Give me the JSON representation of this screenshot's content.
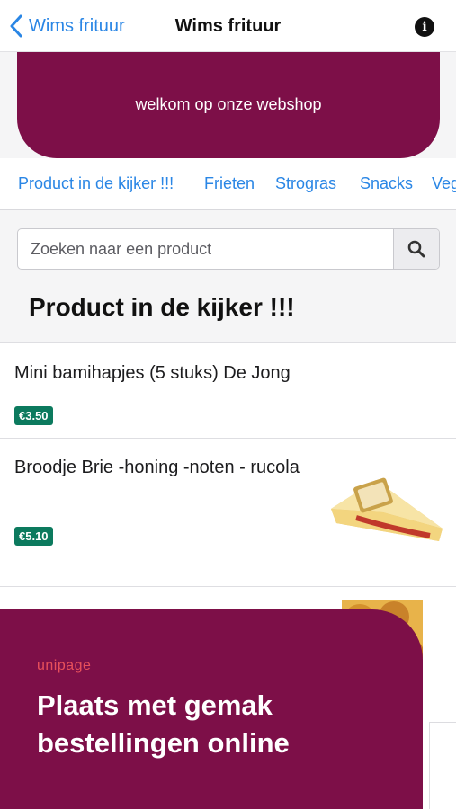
{
  "nav": {
    "back_label": "Wims frituur",
    "title": "Wims frituur",
    "info_symbol": "i"
  },
  "banner": {
    "text": "welkom op onze webshop"
  },
  "tabs": [
    {
      "label": "Product in de kijker !!!"
    },
    {
      "label": "Frieten"
    },
    {
      "label": "Strogras"
    },
    {
      "label": "Snacks"
    },
    {
      "label": "Veg"
    }
  ],
  "search": {
    "placeholder": "Zoeken naar een product",
    "icon": "search-icon"
  },
  "section": {
    "title": "Product in de kijker !!!"
  },
  "products": [
    {
      "name": "Mini bamihapjes (5 stuks) De Jong",
      "price": "€3.50"
    },
    {
      "name": "Broodje Brie -honing -noten - rucola",
      "price": "€5.10"
    }
  ],
  "promo": {
    "logo": "unipage",
    "headline": "Plaats met gemak bestellingen online"
  },
  "colors": {
    "brand": "#7d0f48",
    "link": "#2a86e5",
    "price_badge": "#0c7a5e",
    "logo_accent": "#e8505b"
  }
}
